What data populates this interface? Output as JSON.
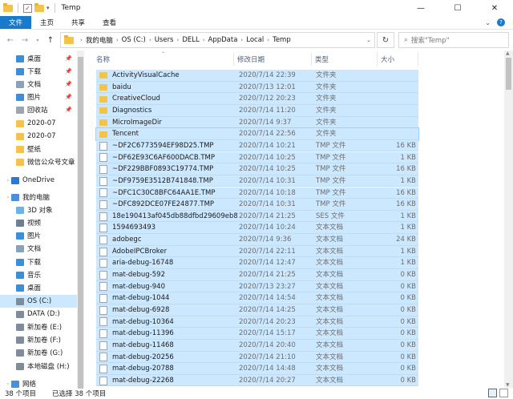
{
  "window": {
    "title": "Temp"
  },
  "ribbon": {
    "tabs": [
      "文件",
      "主页",
      "共享",
      "查看"
    ]
  },
  "address": {
    "crumbs": [
      "我的电脑",
      "OS (C:)",
      "Users",
      "DELL",
      "AppData",
      "Local",
      "Temp"
    ]
  },
  "search": {
    "placeholder": "搜索\"Temp\""
  },
  "columns": {
    "name": "名称",
    "date": "修改日期",
    "type": "类型",
    "size": "大小"
  },
  "nav": [
    {
      "label": "桌面",
      "icon": "desktop-icon",
      "color": "#3b8ed8",
      "pinned": true
    },
    {
      "label": "下载",
      "icon": "download-icon",
      "color": "#3b8ed8",
      "pinned": true
    },
    {
      "label": "文档",
      "icon": "documents-icon",
      "color": "#8aa2b8",
      "pinned": true
    },
    {
      "label": "图片",
      "icon": "pictures-icon",
      "color": "#3b8ed8",
      "pinned": true
    },
    {
      "label": "回收站",
      "icon": "recycle-bin-icon",
      "color": "#9aa6b2",
      "pinned": true
    },
    {
      "label": "2020-07",
      "icon": "folder-icon",
      "color": "#f3c34a",
      "pinned": false
    },
    {
      "label": "2020-07",
      "icon": "folder-icon",
      "color": "#f3c34a",
      "pinned": false
    },
    {
      "label": "壁纸",
      "icon": "folder-icon",
      "color": "#f3c34a",
      "pinned": false
    },
    {
      "label": "微信公众号文章",
      "icon": "folder-icon",
      "color": "#f3c34a",
      "pinned": false
    },
    {
      "label": "OneDrive",
      "icon": "onedrive-icon",
      "color": "#2b79d6",
      "pinned": false
    },
    {
      "label": "我的电脑",
      "icon": "computer-icon",
      "color": "#4a90d9",
      "pinned": false
    },
    {
      "label": "3D 对象",
      "icon": "3d-objects-icon",
      "color": "#6fb3e6",
      "pinned": false
    },
    {
      "label": "视频",
      "icon": "videos-icon",
      "color": "#6d7f91",
      "pinned": false
    },
    {
      "label": "图片",
      "icon": "pictures-icon",
      "color": "#3b8ed8",
      "pinned": false
    },
    {
      "label": "文档",
      "icon": "documents-icon",
      "color": "#8aa2b8",
      "pinned": false
    },
    {
      "label": "下载",
      "icon": "download-icon",
      "color": "#3b8ed8",
      "pinned": false
    },
    {
      "label": "音乐",
      "icon": "music-icon",
      "color": "#3b8ed8",
      "pinned": false
    },
    {
      "label": "桌面",
      "icon": "desktop-icon",
      "color": "#3b8ed8",
      "pinned": false
    },
    {
      "label": "OS (C:)",
      "icon": "drive-icon",
      "color": "#7f8c99",
      "pinned": false,
      "selected": true
    },
    {
      "label": "DATA (D:)",
      "icon": "drive-icon",
      "color": "#7f8c99",
      "pinned": false
    },
    {
      "label": "新加卷 (E:)",
      "icon": "drive-icon",
      "color": "#7f8c99",
      "pinned": false
    },
    {
      "label": "新加卷 (F:)",
      "icon": "drive-icon",
      "color": "#7f8c99",
      "pinned": false
    },
    {
      "label": "新加卷 (G:)",
      "icon": "drive-icon",
      "color": "#7f8c99",
      "pinned": false
    },
    {
      "label": "本地磁盘 (H:)",
      "icon": "drive-icon",
      "color": "#7f8c99",
      "pinned": false
    },
    {
      "label": "网络",
      "icon": "network-icon",
      "color": "#4a90d9",
      "pinned": false
    }
  ],
  "files": [
    {
      "name": "ActivityVisualCache",
      "date": "2020/7/14 22:39",
      "type": "文件夹",
      "size": "",
      "kind": "folder"
    },
    {
      "name": "baidu",
      "date": "2020/7/13 12:01",
      "type": "文件夹",
      "size": "",
      "kind": "folder"
    },
    {
      "name": "CreativeCloud",
      "date": "2020/7/12 20:23",
      "type": "文件夹",
      "size": "",
      "kind": "folder"
    },
    {
      "name": "Diagnostics",
      "date": "2020/7/14 11:20",
      "type": "文件夹",
      "size": "",
      "kind": "folder"
    },
    {
      "name": "MicroImageDir",
      "date": "2020/7/14 9:37",
      "type": "文件夹",
      "size": "",
      "kind": "folder"
    },
    {
      "name": "Tencent",
      "date": "2020/7/14 22:56",
      "type": "文件夹",
      "size": "",
      "kind": "folder"
    },
    {
      "name": "~DF2C6773594EF98D25.TMP",
      "date": "2020/7/14 10:21",
      "type": "TMP 文件",
      "size": "16 KB",
      "kind": "file"
    },
    {
      "name": "~DF62E93C6AF600DACB.TMP",
      "date": "2020/7/14 10:25",
      "type": "TMP 文件",
      "size": "1 KB",
      "kind": "file"
    },
    {
      "name": "~DF229BBF0893C19774.TMP",
      "date": "2020/7/14 10:25",
      "type": "TMP 文件",
      "size": "16 KB",
      "kind": "file"
    },
    {
      "name": "~DF9759E3512B741848.TMP",
      "date": "2020/7/14 10:31",
      "type": "TMP 文件",
      "size": "1 KB",
      "kind": "file"
    },
    {
      "name": "~DFC1C30C8BFC64AA1E.TMP",
      "date": "2020/7/14 10:18",
      "type": "TMP 文件",
      "size": "16 KB",
      "kind": "file"
    },
    {
      "name": "~DFC892DCE07FE24877.TMP",
      "date": "2020/7/14 10:31",
      "type": "TMP 文件",
      "size": "16 KB",
      "kind": "file"
    },
    {
      "name": "18e190413af045db88dfbd29609eb8...",
      "date": "2020/7/14 21:25",
      "type": "SES 文件",
      "size": "1 KB",
      "kind": "file"
    },
    {
      "name": "1594693493",
      "date": "2020/7/14 10:24",
      "type": "文本文档",
      "size": "1 KB",
      "kind": "file"
    },
    {
      "name": "adobegc",
      "date": "2020/7/14 9:36",
      "type": "文本文档",
      "size": "24 KB",
      "kind": "file"
    },
    {
      "name": "AdobeIPCBroker",
      "date": "2020/7/14 22:11",
      "type": "文本文档",
      "size": "1 KB",
      "kind": "file"
    },
    {
      "name": "aria-debug-16748",
      "date": "2020/7/14 12:47",
      "type": "文本文档",
      "size": "1 KB",
      "kind": "file"
    },
    {
      "name": "mat-debug-592",
      "date": "2020/7/14 21:25",
      "type": "文本文档",
      "size": "0 KB",
      "kind": "file"
    },
    {
      "name": "mat-debug-940",
      "date": "2020/7/13 23:27",
      "type": "文本文档",
      "size": "0 KB",
      "kind": "file"
    },
    {
      "name": "mat-debug-1044",
      "date": "2020/7/14 14:54",
      "type": "文本文档",
      "size": "0 KB",
      "kind": "file"
    },
    {
      "name": "mat-debug-6928",
      "date": "2020/7/14 14:25",
      "type": "文本文档",
      "size": "0 KB",
      "kind": "file"
    },
    {
      "name": "mat-debug-10364",
      "date": "2020/7/14 20:23",
      "type": "文本文档",
      "size": "0 KB",
      "kind": "file"
    },
    {
      "name": "mat-debug-11396",
      "date": "2020/7/14 15:17",
      "type": "文本文档",
      "size": "0 KB",
      "kind": "file"
    },
    {
      "name": "mat-debug-11468",
      "date": "2020/7/14 20:40",
      "type": "文本文档",
      "size": "0 KB",
      "kind": "file"
    },
    {
      "name": "mat-debug-20256",
      "date": "2020/7/14 21:10",
      "type": "文本文档",
      "size": "0 KB",
      "kind": "file"
    },
    {
      "name": "mat-debug-20788",
      "date": "2020/7/14 14:48",
      "type": "文本文档",
      "size": "0 KB",
      "kind": "file"
    },
    {
      "name": "mat-debug-22268",
      "date": "2020/7/14 20:27",
      "type": "文本文档",
      "size": "0 KB",
      "kind": "file"
    }
  ],
  "status": {
    "count": "38 个项目",
    "selected": "已选择 38 个项目"
  },
  "colors": {
    "accent": "#1979ca",
    "selection": "#cce8ff",
    "folder": "#f3c34a"
  }
}
